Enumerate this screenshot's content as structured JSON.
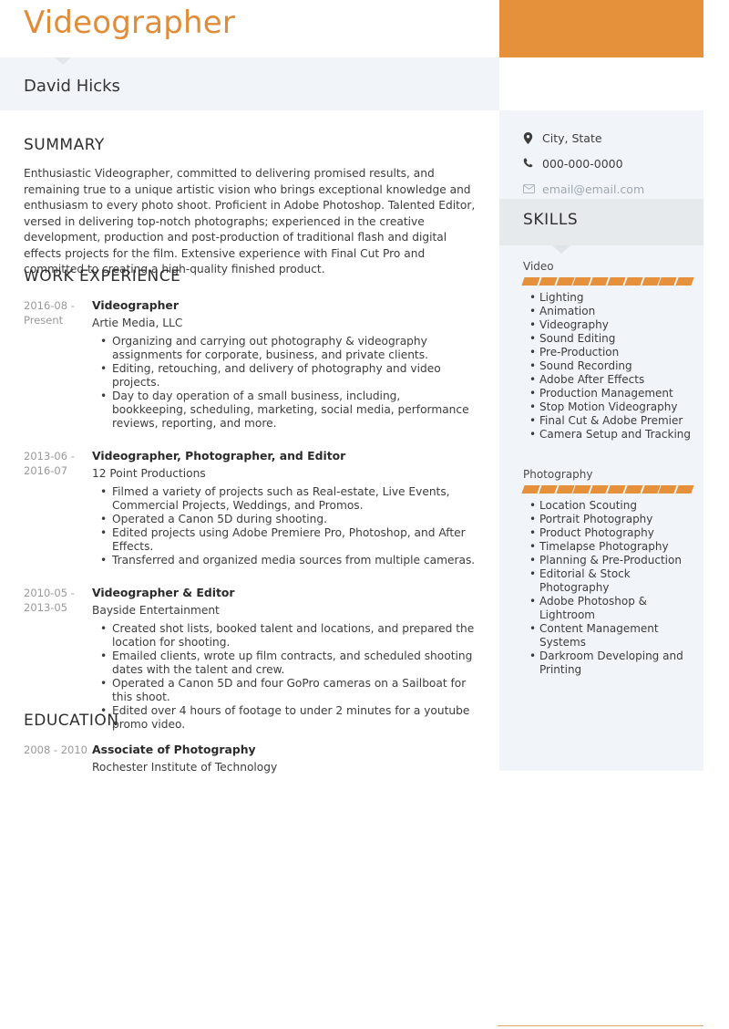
{
  "header": {
    "title": "Videographer",
    "accent_color": "#e5903a",
    "name": "David Hicks",
    "name_band_color": "#f1f5f9"
  },
  "sidebar": {
    "background_color": "#f1f5f9",
    "contact": [
      {
        "icon": "location-pin-icon",
        "text": "City, State"
      },
      {
        "icon": "phone-icon",
        "text": "000-000-0000"
      },
      {
        "icon": "envelope-icon",
        "text": "email@email.com"
      }
    ],
    "skills_title": "SKILLS",
    "skill_groups": [
      {
        "name": "Video",
        "level_segments": 10,
        "level_filled": 10,
        "items": [
          "Lighting",
          "Animation",
          "Videography",
          "Sound Editing",
          "Pre-Production",
          "Sound Recording",
          "Adobe After Effects",
          "Production Management",
          "Stop Motion Videography",
          "Final Cut & Adobe Premier",
          "Camera Setup and Tracking"
        ]
      },
      {
        "name": "Photography",
        "level_segments": 10,
        "level_filled": 10,
        "items": [
          "Location Scouting",
          "Portrait Photography",
          "Product Photography",
          "Timelapse Photography",
          "Planning & Pre-Production",
          "Editorial & Stock Photography",
          "Adobe Photoshop & Lightroom",
          "Content Management Systems",
          "Darkroom Developing and Printing"
        ]
      }
    ]
  },
  "main": {
    "summary": {
      "title": "SUMMARY",
      "text": "Enthusiastic Videographer, committed to delivering promised results, and remaining true to a unique artistic vision who brings exceptional knowledge and enthusiasm to every photo shoot. Proficient in Adobe Photoshop. Talented Editor, versed in delivering top-notch photographs; experienced in the creative development, production and post-production of traditional flash and digital effects projects for the film. Extensive experience with Final Cut Pro and committed to creating a high-quality finished product."
    },
    "experience": {
      "title": "WORK EXPERIENCE",
      "entries": [
        {
          "dates": "2016-08 - Present",
          "role": "Videographer",
          "org": "Artie Media, LLC",
          "bullets": [
            "Organizing and carrying out photography & videography assignments for corporate, business, and private clients.",
            "Editing, retouching, and delivery of photography and video projects.",
            "Day to day operation of a small business, including, bookkeeping, scheduling, marketing, social media, performance reviews, reporting, and more."
          ]
        },
        {
          "dates": "2013-06 - 2016-07",
          "role": "Videographer, Photographer, and Editor",
          "org": "12 Point Productions",
          "bullets": [
            "Filmed a variety of projects such as Real-estate, Live Events, Commercial Projects, Weddings, and Promos.",
            "Operated a Canon 5D during shooting.",
            "Edited projects using Adobe Premiere Pro, Photoshop, and After Effects.",
            "Transferred and organized media sources from multiple cameras."
          ]
        },
        {
          "dates": "2010-05 - 2013-05",
          "role": "Videographer & Editor",
          "org": "Bayside Entertainment",
          "bullets": [
            "Created shot lists, booked talent and locations, and prepared the location for shooting.",
            "Emailed clients, wrote up film contracts, and scheduled shooting dates with the talent and crew.",
            "Operated a Canon 5D and four GoPro cameras on a Sailboat for this shoot.",
            "Edited over 4 hours of footage to under 2 minutes for a youtube promo video."
          ]
        }
      ]
    },
    "education": {
      "title": "EDUCATION",
      "entries": [
        {
          "dates": "2008 - 2010",
          "degree": "Associate of Photography",
          "school": "Rochester Institute of Technology"
        }
      ]
    }
  }
}
